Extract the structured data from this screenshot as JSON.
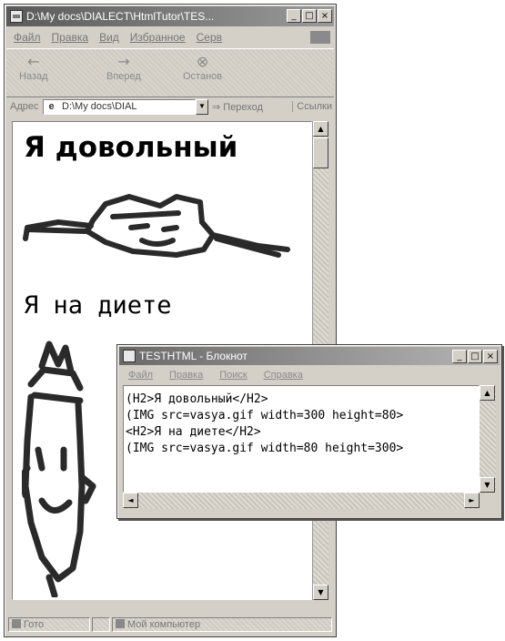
{
  "browser": {
    "title": "D:\\My docs\\DIALECT\\HtmlTutor\\TES...",
    "window_buttons": [
      "_",
      "□",
      "×"
    ],
    "menu": [
      "Файл",
      "Правка",
      "Вид",
      "Избранное",
      "Серв"
    ],
    "toolbar": {
      "back_label": "Назад",
      "forward_label": "Вперед",
      "stop_label": "Останов"
    },
    "address": {
      "label": "Адрес",
      "value": "D:\\My docs\\DIAL",
      "go_label": "Переход",
      "links_label": "Ссылки"
    },
    "page": {
      "heading1": "Я довольный",
      "heading2": "Я на диете"
    },
    "status": {
      "left": "Гото",
      "zone": "Мой компьютер"
    }
  },
  "notepad": {
    "title": "TESTHTML - Блокнот",
    "menu": [
      "Файл",
      "Правка",
      "Поиск",
      "Справка"
    ],
    "lines": [
      "(H2>Я довольный</H2>",
      "(IMG src=vasya.gif width=300 height=80>",
      "<H2>Я на диете</H2>",
      "(IMG src=vasya.gif width=80 height=300>"
    ]
  },
  "icons": [
    "ie-page-icon",
    "back-arrow-icon",
    "forward-arrow-icon",
    "stop-icon",
    "notepad-icon",
    "computer-icon"
  ]
}
